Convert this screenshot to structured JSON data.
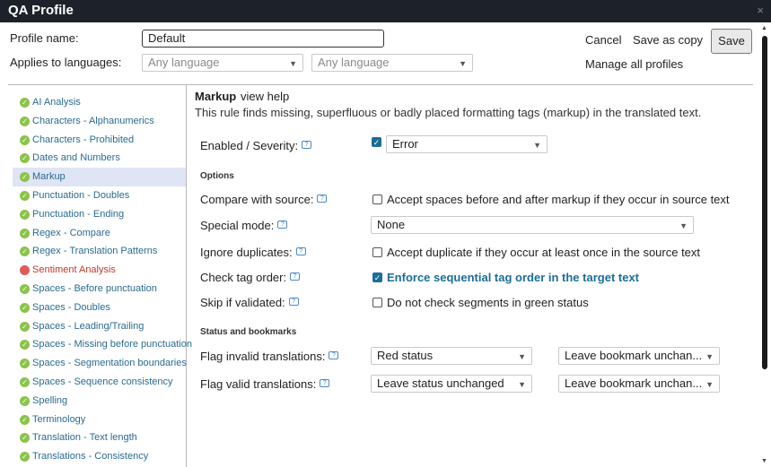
{
  "window": {
    "title": "QA Profile",
    "close": "×"
  },
  "profile": {
    "name_label": "Profile name:",
    "name_value": "Default",
    "applies_label": "Applies to languages:",
    "lang1": "Any language",
    "lang2": "Any language"
  },
  "actions": {
    "cancel": "Cancel",
    "save_copy": "Save as copy",
    "save": "Save",
    "manage": "Manage all profiles"
  },
  "sidebar": {
    "items": [
      {
        "label": "AI Analysis",
        "status": "ok"
      },
      {
        "label": "Characters - Alphanumerics",
        "status": "ok"
      },
      {
        "label": "Characters - Prohibited",
        "status": "ok"
      },
      {
        "label": "Dates and Numbers",
        "status": "ok"
      },
      {
        "label": "Markup",
        "status": "ok",
        "selected": true
      },
      {
        "label": "Punctuation - Doubles",
        "status": "ok"
      },
      {
        "label": "Punctuation - Ending",
        "status": "ok"
      },
      {
        "label": "Regex - Compare",
        "status": "ok"
      },
      {
        "label": "Regex - Translation Patterns",
        "status": "ok"
      },
      {
        "label": "Sentiment Analysis",
        "status": "error"
      },
      {
        "label": "Spaces - Before punctuation",
        "status": "ok"
      },
      {
        "label": "Spaces - Doubles",
        "status": "ok"
      },
      {
        "label": "Spaces - Leading/Trailing",
        "status": "ok"
      },
      {
        "label": "Spaces - Missing before punctuation",
        "status": "ok"
      },
      {
        "label": "Spaces - Segmentation boundaries",
        "status": "ok"
      },
      {
        "label": "Spaces - Sequence consistency",
        "status": "ok"
      },
      {
        "label": "Spelling",
        "status": "ok"
      },
      {
        "label": "Terminology",
        "status": "ok"
      },
      {
        "label": "Translation - Text length",
        "status": "ok"
      },
      {
        "label": "Translations - Consistency",
        "status": "ok"
      }
    ]
  },
  "rule": {
    "title": "Markup",
    "help_link": "view help",
    "description": "This rule finds missing, superfluous or badly placed formatting tags (markup) in the translated text.",
    "enabled_label": "Enabled / Severity:",
    "severity": "Error",
    "options_heading": "Options",
    "compare_label": "Compare with source:",
    "compare_option": "Accept spaces before and after markup if they occur in source text",
    "special_label": "Special mode:",
    "special_value": "None",
    "ignore_label": "Ignore duplicates:",
    "ignore_option": "Accept duplicate if they occur at least once in the source text",
    "tagorder_label": "Check tag order:",
    "tagorder_option": "Enforce sequential tag order in the target text",
    "skip_label": "Skip if validated:",
    "skip_option": "Do not check segments in green status",
    "status_heading": "Status and bookmarks",
    "invalid_label": "Flag invalid translations:",
    "invalid_status": "Red status",
    "invalid_bookmark": "Leave bookmark unchan...",
    "valid_label": "Flag valid translations:",
    "valid_status": "Leave status unchanged",
    "valid_bookmark": "Leave bookmark unchan..."
  },
  "colors": {
    "titlebar": "#1d2129",
    "ok_icon": "#8bc34a",
    "error_icon": "#e05a5a",
    "accent": "#1b6e96",
    "selected_row": "#dfe5f5"
  }
}
